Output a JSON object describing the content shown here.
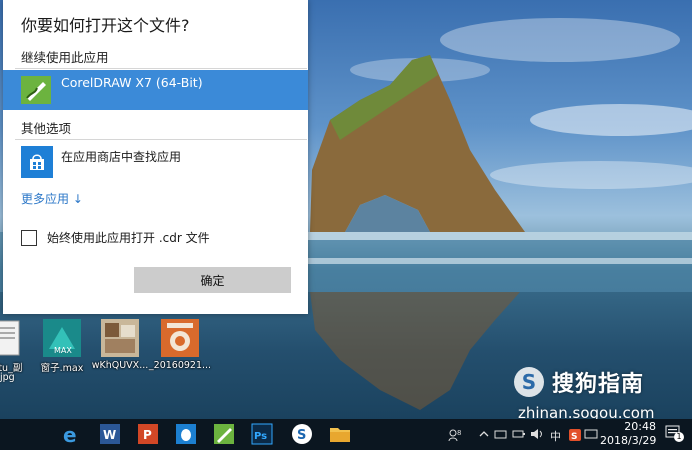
{
  "dialog": {
    "title": "你要如何打开这个文件?",
    "continue_section": "继续使用此应用",
    "app_name": "CorelDRAW X7 (64-Bit)",
    "other_section": "其他选项",
    "store_option": "在应用商店中查找应用",
    "more_apps": "更多应用 ↓",
    "always_use_label": "始终使用此应用打开 .cdr 文件",
    "always_use_checked": false,
    "ok_button": "确定",
    "accent_color": "#3b8ad8"
  },
  "desktop_icons": [
    {
      "label": "intu_副",
      "label2": "jpg",
      "icon": "image-file-icon"
    },
    {
      "label": "窗子.max",
      "icon": "3ds-max-icon"
    },
    {
      "label": "wKhQUVX...",
      "icon": "photo-thumbnail-icon"
    },
    {
      "label": "_20160921...",
      "icon": "image-thumbnail-icon"
    }
  ],
  "watermark": {
    "brand": "搜狗指南",
    "url": "zhinan.sogou.com"
  },
  "taskbar": {
    "apps": [
      "edge-icon",
      "word-icon",
      "powerpoint-icon",
      "qq-icon",
      "coreldraw-icon",
      "photoshop-icon",
      "sogou-icon",
      "file-explorer-icon"
    ],
    "tray_ime": "中",
    "time": "20:48",
    "date": "2018/3/29",
    "notification_count": "1"
  }
}
